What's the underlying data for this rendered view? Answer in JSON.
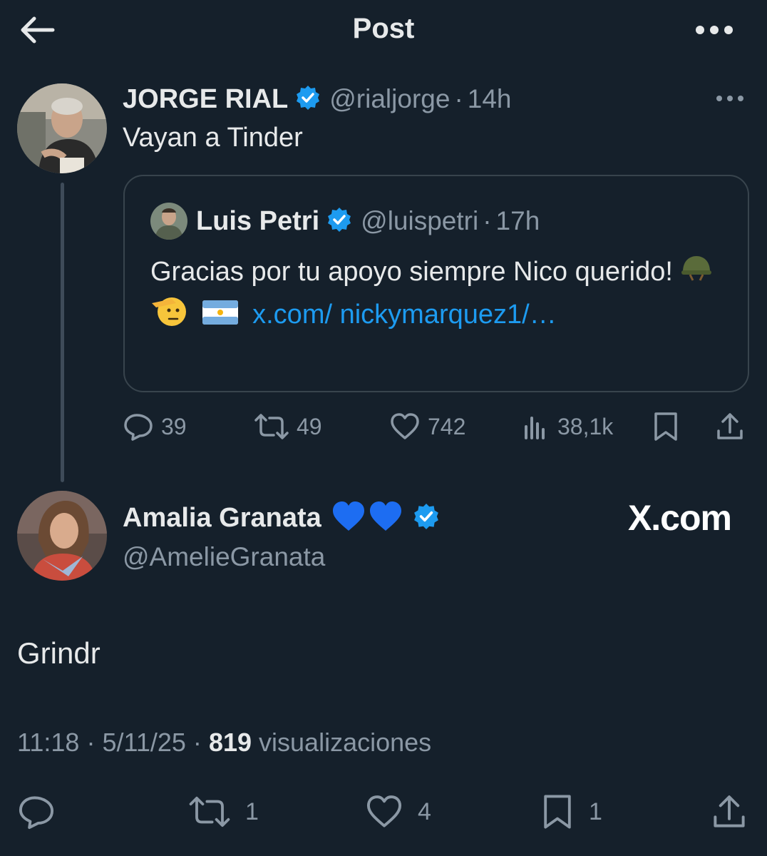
{
  "header": {
    "title": "Post",
    "back_icon": "arrow-left-icon",
    "more_icon": "more-horizontal-icon"
  },
  "tweet": {
    "name": "JORGE RIAL",
    "handle": "@rialjorge",
    "separator": "·",
    "time": "14h",
    "text": "Vayan a Tinder",
    "quote": {
      "name": "Luis Petri",
      "handle": "@luispetri",
      "separator": "·",
      "time": "17h",
      "text_before": "Gracias por tu apoyo siempre Nico querido!",
      "emojis": [
        "military-helmet-emoji",
        "saluting-face-emoji",
        "argentina-flag-emoji"
      ],
      "link": "x.com/ nickymarquez1/…"
    },
    "actions": {
      "replies": "39",
      "reposts": "49",
      "likes": "742",
      "views": "38,1k"
    }
  },
  "reply": {
    "name": "Amalia Granata",
    "name_emojis": "💙💙",
    "handle": "@AmelieGranata",
    "watermark": "X.com",
    "text": "Grindr",
    "time": "11:18",
    "sep1": "·",
    "date": "5/11/25",
    "sep2": "·",
    "views_count": "819",
    "views_label": "visualizaciones",
    "actions": {
      "reposts": "1",
      "likes": "4",
      "bookmarks": "1"
    }
  },
  "colors": {
    "background": "#15202b",
    "text": "#e7e9ea",
    "muted": "#8b98a5",
    "accent": "#1d9bf0",
    "border": "#38444d"
  }
}
